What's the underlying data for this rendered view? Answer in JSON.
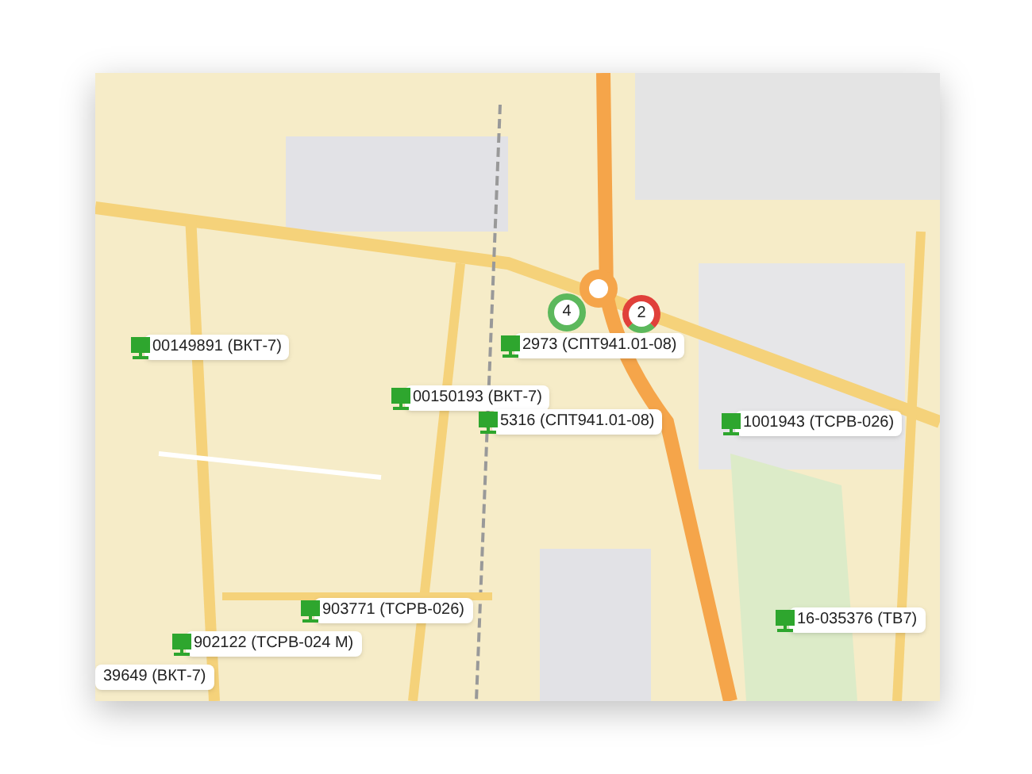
{
  "markers": [
    {
      "label": "00149891 (ВКТ-7)",
      "kind": "device"
    },
    {
      "label": "2973 (СПТ941.01-08)",
      "kind": "device"
    },
    {
      "label": "00150193 (ВКТ-7)",
      "kind": "device"
    },
    {
      "label": "5316 (СПТ941.01-08)",
      "kind": "device"
    },
    {
      "label": "1001943 (ТСРВ-026)",
      "kind": "device"
    },
    {
      "label": "903771 (ТСРВ-026)",
      "kind": "device"
    },
    {
      "label": "16-035376 (ТВ7)",
      "kind": "device"
    },
    {
      "label": "902122 (ТСРВ-024 М)",
      "kind": "device"
    },
    {
      "label": "39649 (ВКТ-7)",
      "kind": "label"
    }
  ],
  "clusters": [
    {
      "count": "4",
      "color": "#5cb85c"
    },
    {
      "count": "2",
      "color": "#e0403a"
    }
  ]
}
